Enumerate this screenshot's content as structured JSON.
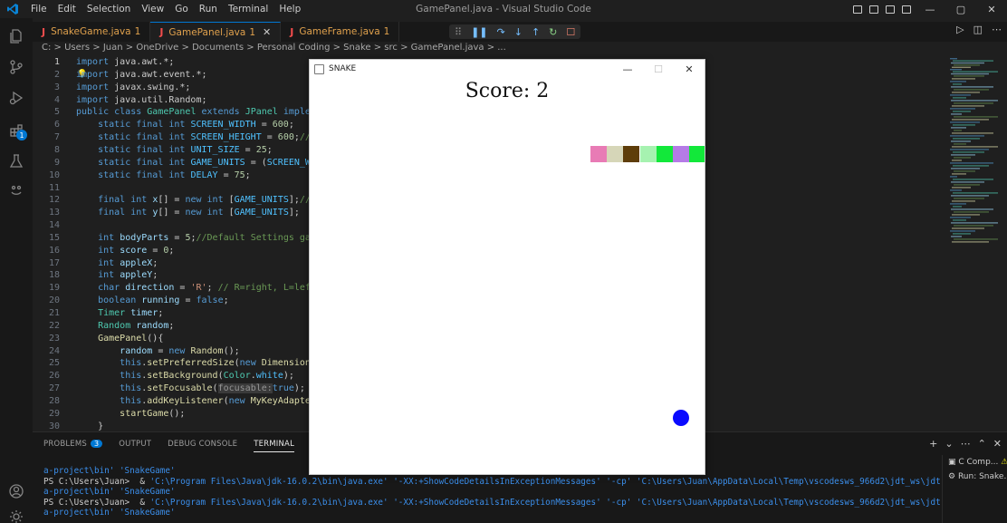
{
  "titlebar": {
    "menu": [
      "File",
      "Edit",
      "Selection",
      "View",
      "Go",
      "Run",
      "Terminal",
      "Help"
    ],
    "window_title": "GamePanel.java - Visual Studio Code",
    "minimize": "—",
    "maximize": "▢",
    "close": "✕"
  },
  "tabs": [
    {
      "file": "SnakeGame.java",
      "count": "1",
      "active": false
    },
    {
      "file": "GamePanel.java",
      "count": "1",
      "active": true
    },
    {
      "file": "GameFrame.java",
      "count": "1",
      "active": false
    }
  ],
  "tab_icon_letter": "J",
  "tab_close": "✕",
  "breadcrumb": "C: > Users > Juan > OneDrive > Documents > Personal Coding > Snake > src > GamePanel.java > ...",
  "activity_badge": "1",
  "code_lines": [
    {
      "n": "1",
      "html": "<span class=\"kw\">import</span> java.awt.*;"
    },
    {
      "n": "2",
      "html": "<span class=\"kw\">import</span> java.awt.event.*;"
    },
    {
      "n": "3",
      "html": "<span class=\"kw\">import</span> javax.swing.*;"
    },
    {
      "n": "4",
      "html": "<span class=\"kw\">import</span> java.util.Random;"
    },
    {
      "n": "5",
      "html": "<span class=\"kw\">public class</span> <span class=\"ty\">GamePanel</span> <span class=\"kw\">extends</span> <span class=\"ty\">JPanel</span> <span class=\"kw\">implemen</span>"
    },
    {
      "n": "6",
      "html": "    <span class=\"kw\">static final int</span> <span class=\"cs\">SCREEN_WIDTH</span> = <span class=\"nm\">600</span>;"
    },
    {
      "n": "7",
      "html": "    <span class=\"kw\">static final int</span> <span class=\"cs\">SCREEN_HEIGHT</span> = <span class=\"nm\">600</span>;<span class=\"cm\">//Scr</span>"
    },
    {
      "n": "8",
      "html": "    <span class=\"kw\">static final int</span> <span class=\"cs\">UNIT_SIZE</span> = <span class=\"nm\">25</span>;"
    },
    {
      "n": "9",
      "html": "    <span class=\"kw\">static final int</span> <span class=\"cs\">GAME_UNITS</span> = (<span class=\"cs\">SCREEN_WIDT</span>"
    },
    {
      "n": "10",
      "html": "    <span class=\"kw\">static final int</span> <span class=\"cs\">DELAY</span> = <span class=\"nm\">75</span>;"
    },
    {
      "n": "11",
      "html": ""
    },
    {
      "n": "12",
      "html": "    <span class=\"kw\">final int</span> <span class=\"vr\">x</span>[] = <span class=\"kw\">new int</span> [<span class=\"cs\">GAME_UNITS</span>];<span class=\"cm\">//Coo</span>"
    },
    {
      "n": "13",
      "html": "    <span class=\"kw\">final int</span> <span class=\"vr\">y</span>[] = <span class=\"kw\">new int</span> [<span class=\"cs\">GAME_UNITS</span>];"
    },
    {
      "n": "14",
      "html": ""
    },
    {
      "n": "15",
      "html": "    <span class=\"kw\">int</span> <span class=\"vr\">bodyParts</span> = <span class=\"nm\">5</span>;<span class=\"cm\">//Default Settings game</span>"
    },
    {
      "n": "16",
      "html": "    <span class=\"kw\">int</span> <span class=\"vr\">score</span> = <span class=\"nm\">0</span>;"
    },
    {
      "n": "17",
      "html": "    <span class=\"kw\">int</span> <span class=\"vr\">appleX</span>;"
    },
    {
      "n": "18",
      "html": "    <span class=\"kw\">int</span> <span class=\"vr\">appleY</span>;"
    },
    {
      "n": "19",
      "html": "    <span class=\"kw\">char</span> <span class=\"vr\">direction</span> = <span class=\"st\">'R'</span>; <span class=\"cm\">// R=right, L=left,</span>"
    },
    {
      "n": "20",
      "html": "    <span class=\"kw\">boolean</span> <span class=\"vr\">running</span> = <span class=\"kw\">false</span>;"
    },
    {
      "n": "21",
      "html": "    <span class=\"ty\">Timer</span> <span class=\"vr\">timer</span>;"
    },
    {
      "n": "22",
      "html": "    <span class=\"ty\">Random</span> <span class=\"vr\">random</span>;"
    },
    {
      "n": "23",
      "html": "    <span class=\"fn\">GamePanel</span>(){"
    },
    {
      "n": "24",
      "html": "        <span class=\"vr\">random</span> = <span class=\"kw\">new</span> <span class=\"fn\">Random</span>();"
    },
    {
      "n": "25",
      "html": "        <span class=\"kw\">this</span>.<span class=\"fn\">setPreferredSize</span>(<span class=\"kw\">new</span> <span class=\"fn\">Dimension</span>(<span class=\"cs\">SC</span>"
    },
    {
      "n": "26",
      "html": "        <span class=\"kw\">this</span>.<span class=\"fn\">setBackground</span>(<span class=\"ty\">Color</span>.<span class=\"cs\">white</span>);"
    },
    {
      "n": "27",
      "html": "        <span class=\"kw\">this</span>.<span class=\"fn\">setFocusable</span>(<span class=\"hint\">focusable:</span><span class=\"kw\">true</span>);"
    },
    {
      "n": "28",
      "html": "        <span class=\"kw\">this</span>.<span class=\"fn\">addKeyListener</span>(<span class=\"kw\">new</span> <span class=\"fn\">MyKeyAdapter</span>()"
    },
    {
      "n": "29",
      "html": "        <span class=\"fn\">startGame</span>();"
    },
    {
      "n": "30",
      "html": "    }"
    }
  ],
  "panel": {
    "tabs": [
      "PROBLEMS",
      "OUTPUT",
      "DEBUG CONSOLE",
      "TERMINAL"
    ],
    "problems_count": "3",
    "active_tab": "TERMINAL",
    "terminal_lines": [
      [
        {
          "c": "bl",
          "t": "a-project\\bin' 'SnakeGame'"
        }
      ],
      [
        {
          "c": "wh",
          "t": "PS C:\\Users\\Juan>  & "
        },
        {
          "c": "bl",
          "t": "'C:\\Program Files\\Java\\jdk-16.0.2\\bin\\java.exe' '-XX:+ShowCodeDetailsInExceptionMessages' '-cp' 'C:\\Users\\Juan\\AppData\\Local\\Temp\\vscodesws_966d2\\jdt_ws\\jdt.ls-jav"
        }
      ],
      [
        {
          "c": "bl",
          "t": "a-project\\bin' 'SnakeGame'"
        }
      ],
      [
        {
          "c": "wh",
          "t": "PS C:\\Users\\Juan>  & "
        },
        {
          "c": "bl",
          "t": "'C:\\Program Files\\Java\\jdk-16.0.2\\bin\\java.exe' '-XX:+ShowCodeDetailsInExceptionMessages' '-cp' 'C:\\Users\\Juan\\AppData\\Local\\Temp\\vscodesws_966d2\\jdt_ws\\jdt.ls-jav"
        }
      ],
      [
        {
          "c": "bl",
          "t": "a-project\\bin' 'SnakeGame'"
        }
      ]
    ],
    "side_items": [
      "C Comp...",
      "Run: Snake..."
    ]
  },
  "snake_window": {
    "title": "SNAKE",
    "score_label": "Score: 2",
    "snake_colors": [
      "#e87bb5",
      "#d6d6b8",
      "#5e3d0a",
      "#a6f2b0",
      "#12e83a",
      "#b57be6",
      "#12e83a"
    ],
    "apple_color": "#0a0aff"
  }
}
